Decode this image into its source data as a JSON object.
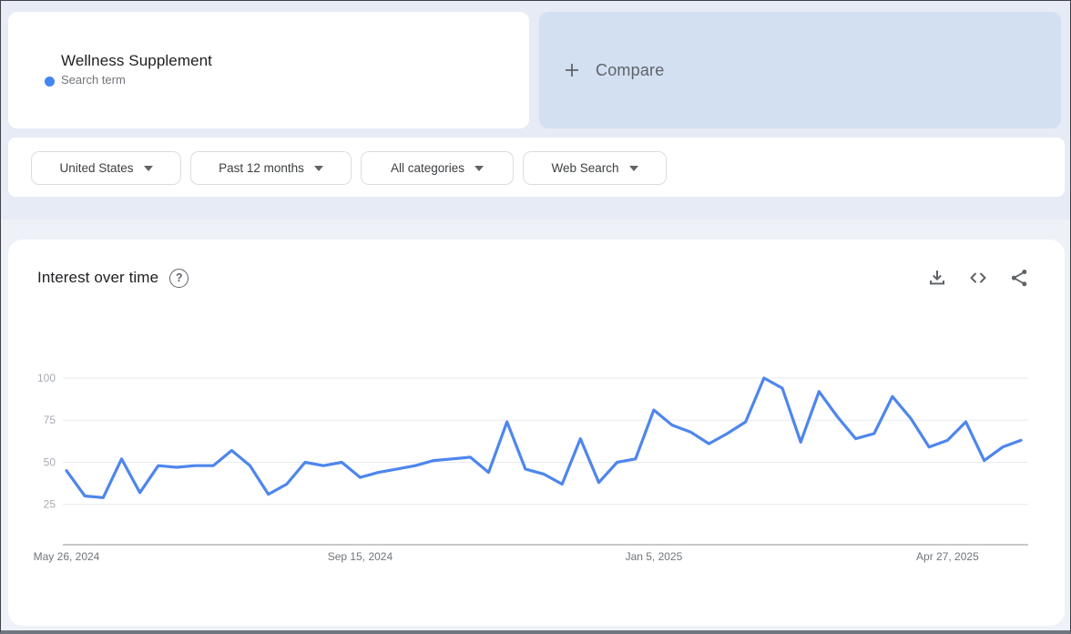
{
  "term_card": {
    "title": "Wellness Supplement",
    "subtitle": "Search term",
    "dot_color": "#4285f4"
  },
  "compare_card": {
    "label": "Compare",
    "plus_icon": "plus-icon",
    "background": "#d3e0f2"
  },
  "filters": {
    "items": [
      {
        "label": "United States"
      },
      {
        "label": "Past 12 months"
      },
      {
        "label": "All categories"
      },
      {
        "label": "Web Search"
      }
    ]
  },
  "section": {
    "title": "Interest over time",
    "help_glyph": "?",
    "icons": [
      "download-icon",
      "embed-icon",
      "share-icon"
    ],
    "icon_color": "#5f6368"
  },
  "chart_data": {
    "type": "line",
    "title": "Interest over time",
    "frequency_hint": "weekly points",
    "ylim": [
      0,
      100
    ],
    "y_ticks": [
      25,
      50,
      75,
      100
    ],
    "grid": true,
    "x_tick_labels": [
      "May 26, 2024",
      "Sep 15, 2024",
      "Jan 5, 2025",
      "Apr 27, 2025"
    ],
    "x_tick_indices": [
      0,
      16,
      32,
      48
    ],
    "series": [
      {
        "name": "Wellness Supplement",
        "color": "#4e86ec",
        "values": [
          45,
          30,
          29,
          52,
          32,
          48,
          47,
          48,
          48,
          57,
          48,
          31,
          37,
          50,
          48,
          50,
          41,
          44,
          46,
          48,
          51,
          52,
          53,
          44,
          74,
          46,
          43,
          37,
          64,
          38,
          50,
          52,
          81,
          72,
          68,
          61,
          67,
          74,
          100,
          94,
          62,
          92,
          77,
          64,
          67,
          89,
          76,
          59,
          63,
          74,
          51,
          59,
          63
        ]
      }
    ],
    "axis_color": "#8f9499",
    "gridline_color": "#e8eaee",
    "x_label_color": "#70757a",
    "y_label_color": "#a6abb2"
  }
}
